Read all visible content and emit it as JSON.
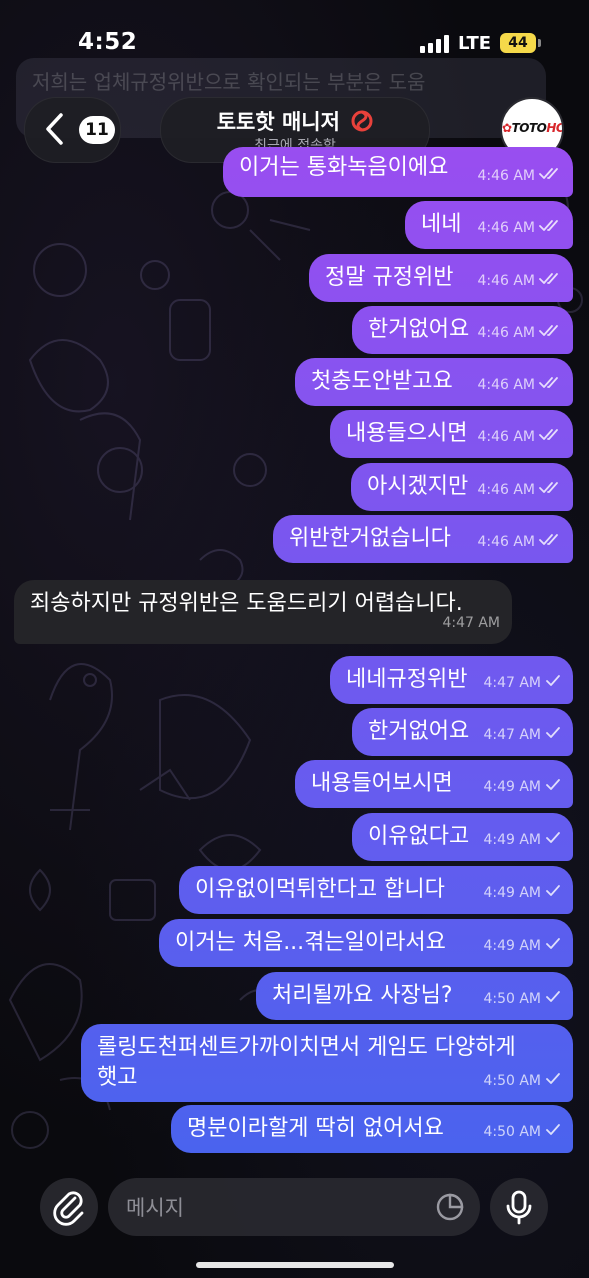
{
  "status_bar": {
    "time": "4:52",
    "network": "LTE",
    "battery": "44"
  },
  "ghost_message": "저희는 업체규정위반으로 확인되는 부분은 도움",
  "header": {
    "back_count": "11",
    "title": "토토핫 매니저",
    "subtitle": "최근에 접속함",
    "avatar_logo_main": "TOTO",
    "avatar_logo_accent": "HOT"
  },
  "messages": [
    {
      "text": "이거는 통화녹음이에요",
      "time": "4:46 AM",
      "read": true
    },
    {
      "text": "네네",
      "time": "4:46 AM",
      "read": true
    },
    {
      "text": "정말 규정위반",
      "time": "4:46 AM",
      "read": true
    },
    {
      "text": "한거없어요",
      "time": "4:46 AM",
      "read": true
    },
    {
      "text": "첫충도안받고요",
      "time": "4:46 AM",
      "read": true
    },
    {
      "text": "내용들으시면",
      "time": "4:46 AM",
      "read": true
    },
    {
      "text": "아시겠지만",
      "time": "4:46 AM",
      "read": true
    },
    {
      "text": "위반한거없습니다",
      "time": "4:46 AM",
      "read": true
    },
    {
      "incoming": true,
      "text": "죄송하지만 규정위반은 도움드리기 어렵습니다.",
      "time": "4:47 AM"
    },
    {
      "text": "네네규정위반",
      "time": "4:47 AM",
      "read": false
    },
    {
      "text": "한거없어요",
      "time": "4:47 AM",
      "read": false
    },
    {
      "text": "내용들어보시면",
      "time": "4:49 AM",
      "read": false
    },
    {
      "text": "이유없다고",
      "time": "4:49 AM",
      "read": false
    },
    {
      "text": "이유없이먹튀한다고 합니다",
      "time": "4:49 AM",
      "read": false
    },
    {
      "text": "이거는 처음...겪는일이라서요",
      "time": "4:49 AM",
      "read": false
    },
    {
      "text": "처리될까요 사장님?",
      "time": "4:50 AM",
      "read": false
    },
    {
      "text_line1": "롤링도천퍼센트가까이치면서 게임도 다양하게",
      "text_line2": "햇고",
      "time": "4:50 AM",
      "read": false
    },
    {
      "text": "명분이라할게 딱히 없어서요",
      "time": "4:50 AM",
      "read": false
    }
  ],
  "composer": {
    "placeholder": "메시지"
  },
  "colors": {
    "bubble_top": "#9a4ef0",
    "bubble_bottom": "#4a63ee",
    "incoming_bubble": "#242428"
  }
}
